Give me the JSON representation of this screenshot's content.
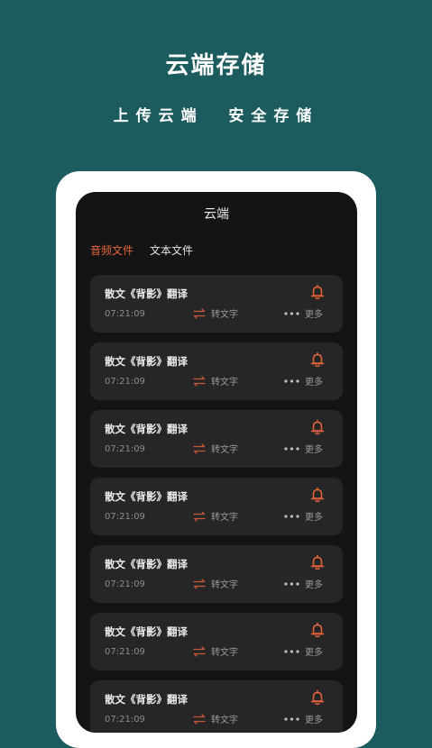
{
  "hero": {
    "title": "云端存储",
    "subtitle": "上传云端  安全存储"
  },
  "screen": {
    "title": "云端",
    "tabs": [
      {
        "label": "音频文件",
        "active": true
      },
      {
        "label": "文本文件",
        "active": false
      }
    ]
  },
  "colors": {
    "background": "#1c5c5f",
    "accent": "#e8643a",
    "card": "#262626",
    "screen": "#141414"
  },
  "icons": {
    "bell": "bell-icon",
    "transfer": "swap-arrows-icon",
    "more": "more-dots-icon"
  },
  "items": [
    {
      "title": "散文《背影》翻译",
      "time": "07:21:09",
      "transfer_label": "转文字",
      "more_label": "更多"
    },
    {
      "title": "散文《背影》翻译",
      "time": "07:21:09",
      "transfer_label": "转文字",
      "more_label": "更多"
    },
    {
      "title": "散文《背影》翻译",
      "time": "07:21:09",
      "transfer_label": "转文字",
      "more_label": "更多"
    },
    {
      "title": "散文《背影》翻译",
      "time": "07:21:09",
      "transfer_label": "转文字",
      "more_label": "更多"
    },
    {
      "title": "散文《背影》翻译",
      "time": "07:21:09",
      "transfer_label": "转文字",
      "more_label": "更多"
    },
    {
      "title": "散文《背影》翻译",
      "time": "07:21:09",
      "transfer_label": "转文字",
      "more_label": "更多"
    },
    {
      "title": "散文《背影》翻译",
      "time": "07:21:09",
      "transfer_label": "转文字",
      "more_label": "更多"
    }
  ]
}
